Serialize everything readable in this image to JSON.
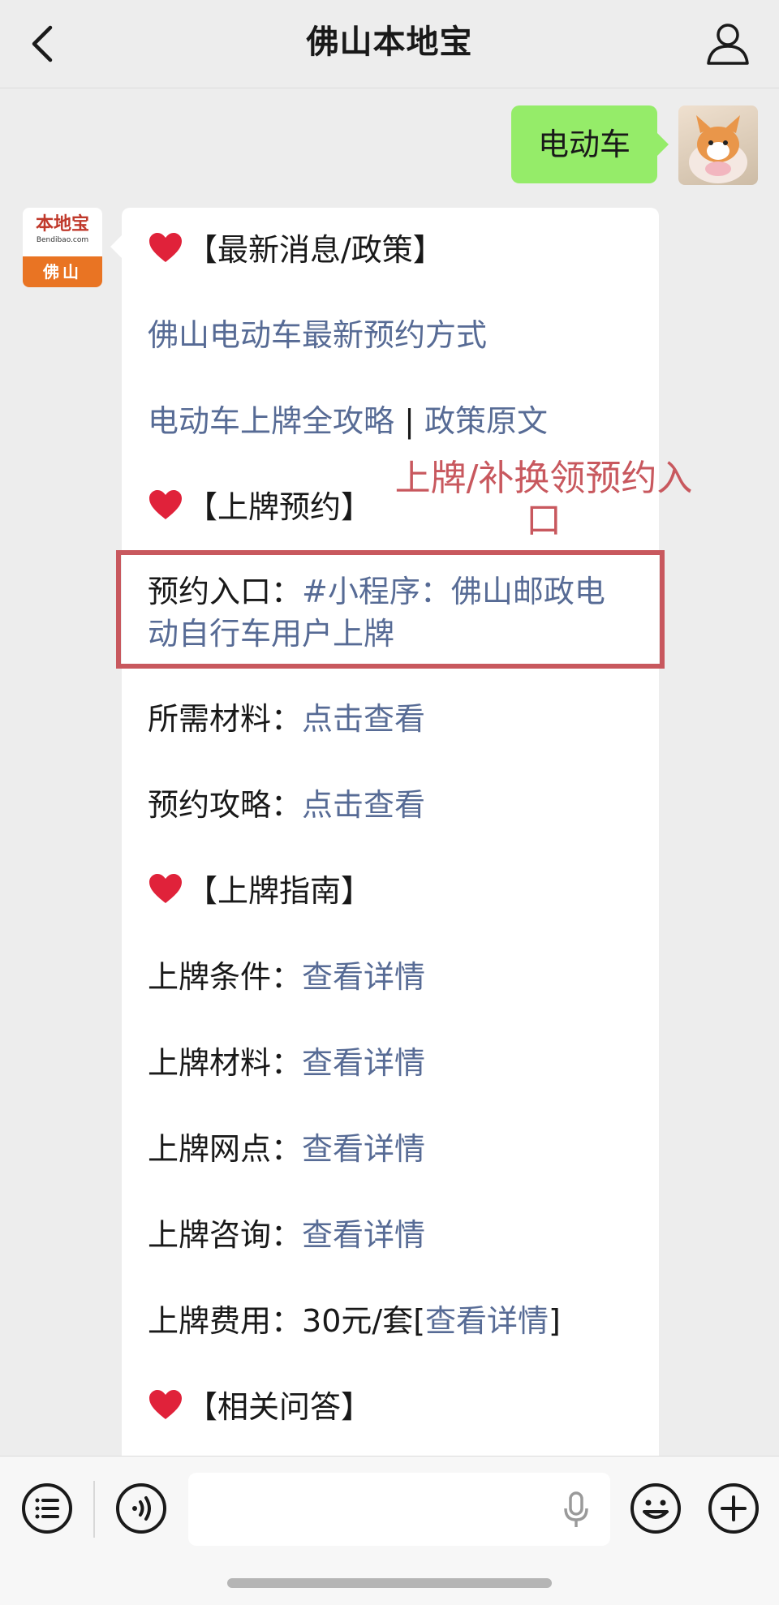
{
  "header": {
    "title": "佛山本地宝"
  },
  "outgoing": {
    "text": "电动车"
  },
  "bot": {
    "logo_text": "本地宝",
    "logo_url": "Bendibao.com",
    "city": "佛山"
  },
  "message": {
    "sections": [
      {
        "title": "【最新消息/政策】"
      },
      {
        "title": "【上牌预约】"
      },
      {
        "title": "【上牌指南】"
      },
      {
        "title": "【相关问答】"
      }
    ],
    "news_links": [
      "佛山电动车最新预约方式",
      "电动车上牌全攻略",
      "政策原文"
    ],
    "separator": "|",
    "booking_entry": {
      "label": "预约入口：",
      "line1": "#小程序：佛山邮政电",
      "line2": "动自行车用户上牌"
    },
    "materials": {
      "label": "所需材料：",
      "link": "点击查看"
    },
    "strategy": {
      "label": "预约攻略：",
      "link": "点击查看"
    },
    "guide": [
      {
        "label": "上牌条件：",
        "link": "查看详情"
      },
      {
        "label": "上牌材料：",
        "link": "查看详情"
      },
      {
        "label": "上牌网点：",
        "link": "查看详情"
      },
      {
        "label": "上牌咨询：",
        "link": "查看详情"
      }
    ],
    "fee": {
      "label": "上牌费用：",
      "value": "30元/套",
      "open": "[",
      "link": "查看详情",
      "close": "]"
    }
  },
  "annotation": {
    "line1": "上牌/补换领预约入",
    "line2": "口"
  },
  "colors": {
    "link": "#576b95",
    "highlight": "#c8585e",
    "bubble_green": "#95ec69",
    "heart": "#e0223a"
  },
  "icons": [
    "chevron-left-icon",
    "user-icon",
    "heart-icon",
    "menu-list-icon",
    "voice-icon",
    "microphone-icon",
    "emoji-icon",
    "plus-icon"
  ]
}
